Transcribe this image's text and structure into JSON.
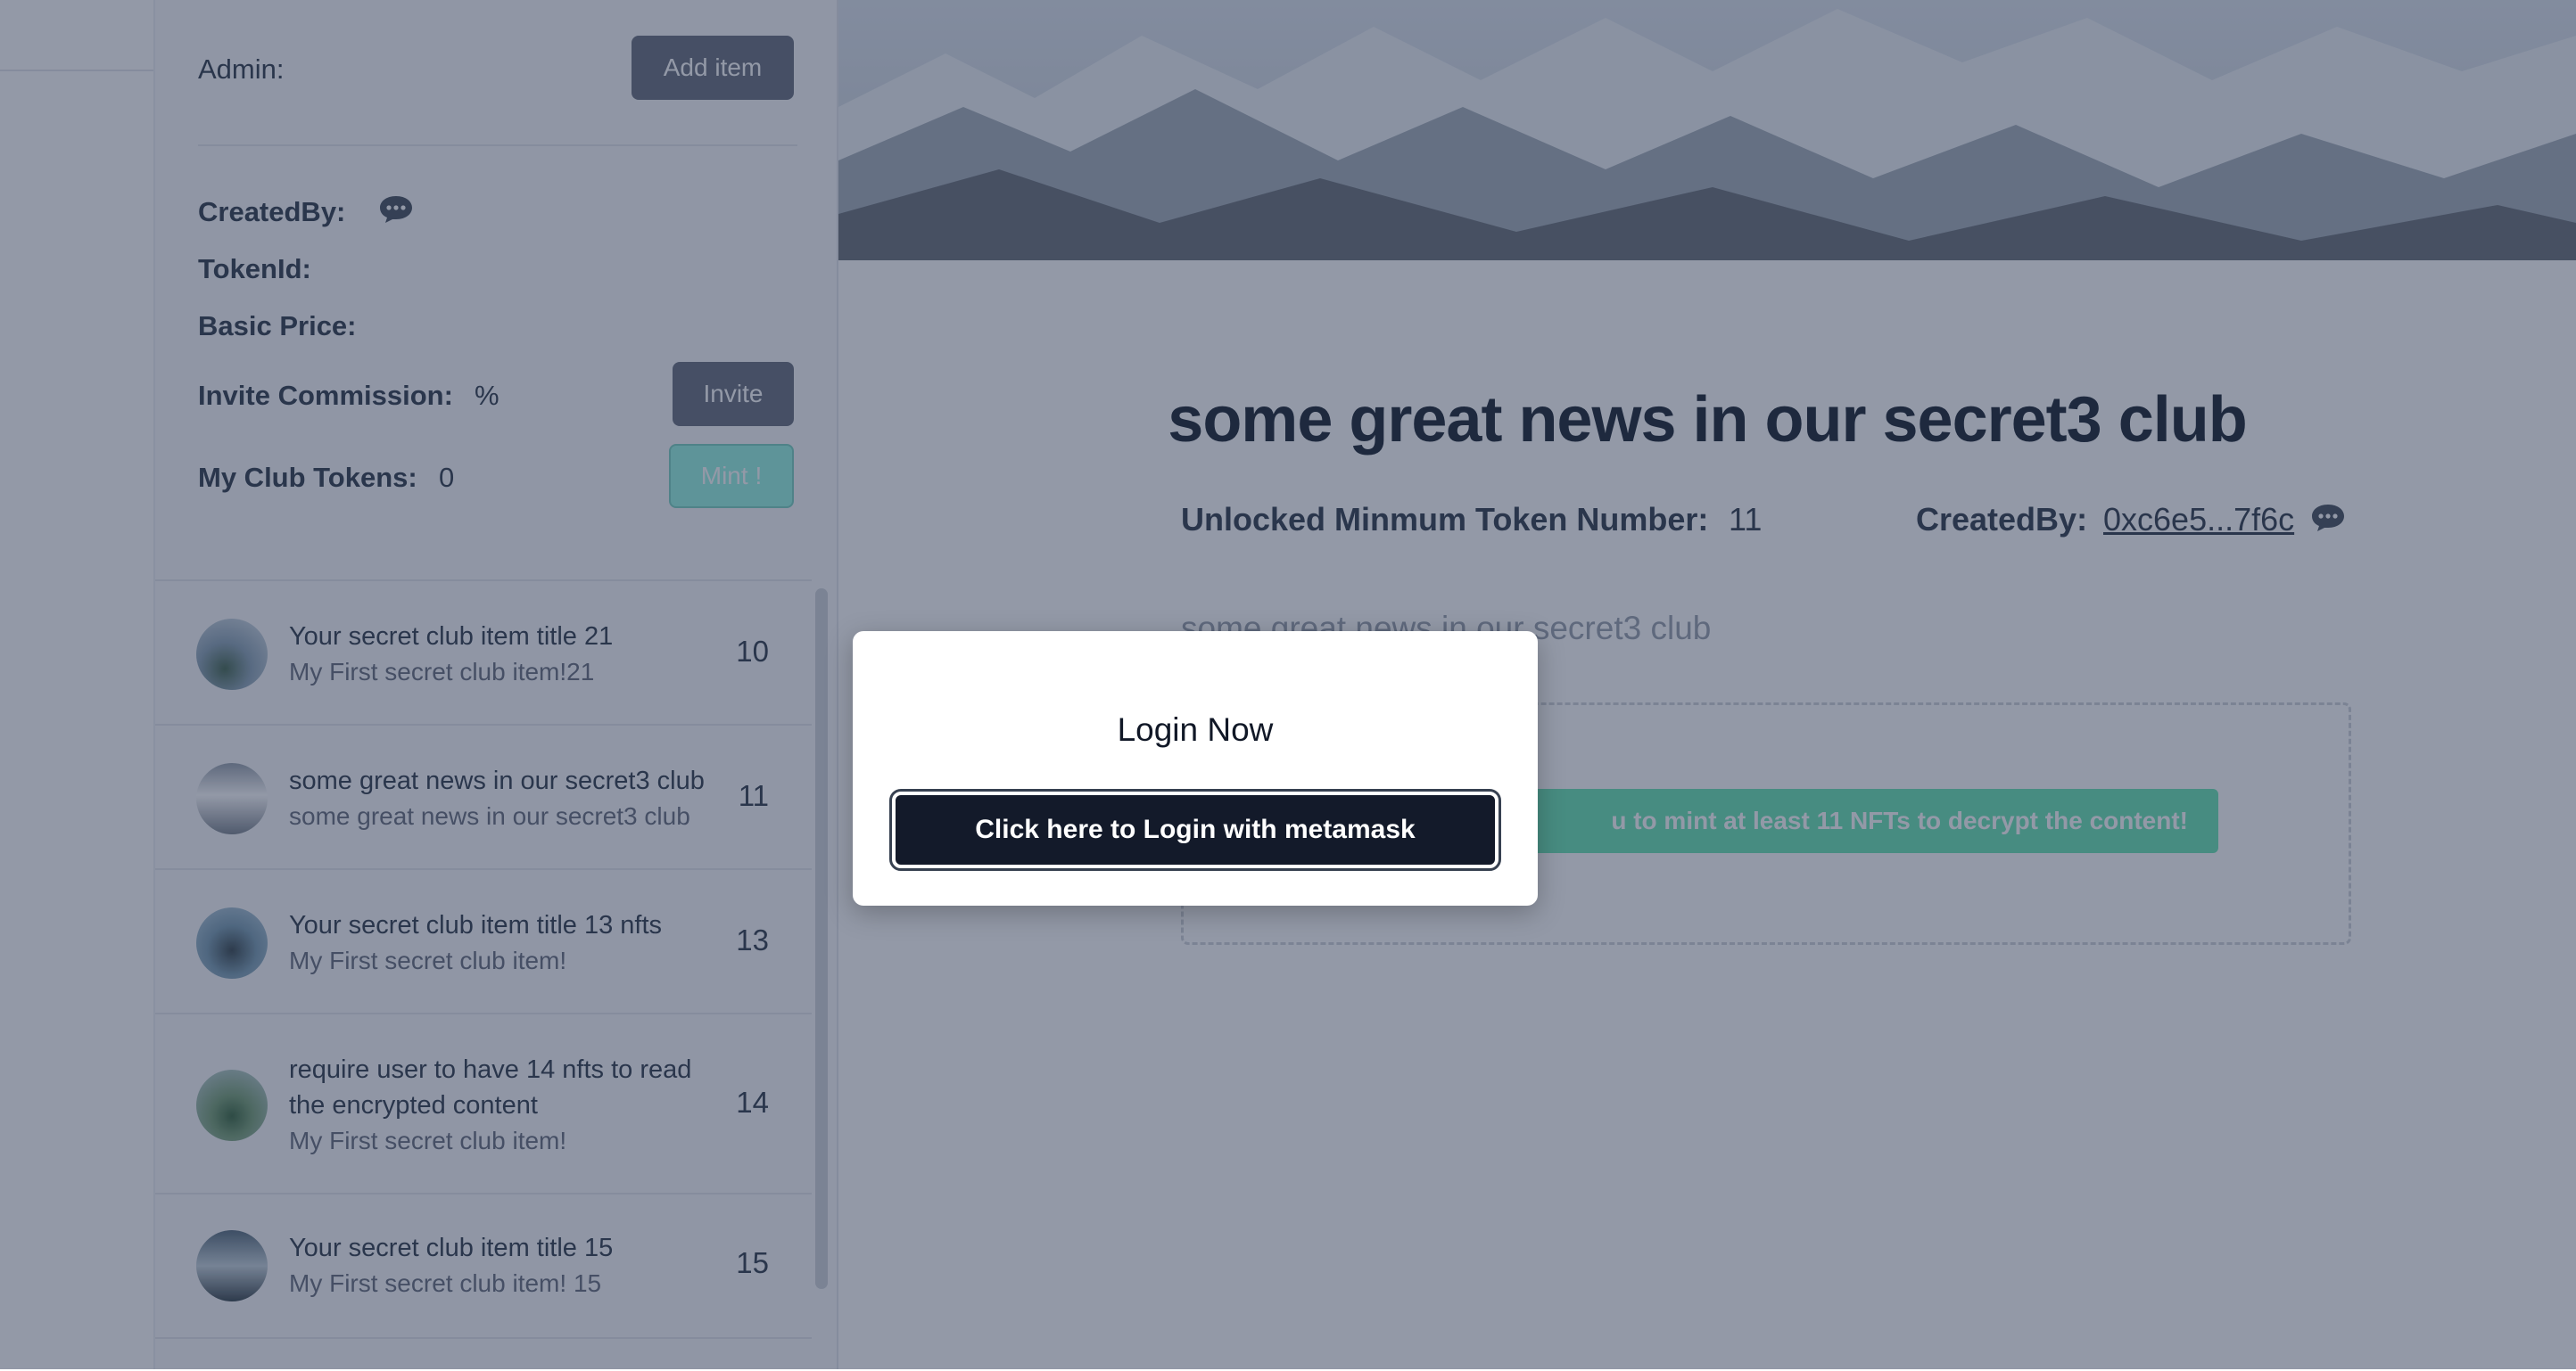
{
  "sidebar": {
    "admin_label": "Admin:",
    "add_item_label": "Add item",
    "created_by_label": "CreatedBy:",
    "token_id_label": "TokenId:",
    "basic_price_label": "Basic Price:",
    "invite_commission_label": "Invite Commission:",
    "invite_commission_value": "%",
    "invite_label": "Invite",
    "my_club_tokens_label": "My Club Tokens:",
    "my_club_tokens_value": "0",
    "mint_label": "Mint !",
    "items": [
      {
        "title": "Your secret club item title 21",
        "subtitle": "My First secret club item!21",
        "count": "10"
      },
      {
        "title": "some great news in our secret3 club",
        "subtitle": "some great news in our secret3 club",
        "count": "11"
      },
      {
        "title": "Your secret club item title 13 nfts",
        "subtitle": "My First secret club item!",
        "count": "13"
      },
      {
        "title": "require user to have 14 nfts to read the encrypted content",
        "subtitle": "My First secret club item!",
        "count": "14"
      },
      {
        "title": "Your secret club item title 15",
        "subtitle": "My First secret club item! 15",
        "count": "15"
      }
    ]
  },
  "main": {
    "headline": "some great news in our secret3 club",
    "unlock_label": "Unlocked Minmum Token Number:",
    "unlock_value": "11",
    "created_by_label": "CreatedBy:",
    "created_by_value": "0xc6e5...7f6c",
    "description": "some great news in our secret3 club",
    "mint_notice": "u to mint at least 11 NFTs to decrypt the content!"
  },
  "modal": {
    "title": "Login Now",
    "login_button": "Click here to Login with metamask"
  },
  "colors": {
    "overlay": "#1e2948",
    "login_button": "#131a2a",
    "mint_accent": "#6ee7b7"
  }
}
